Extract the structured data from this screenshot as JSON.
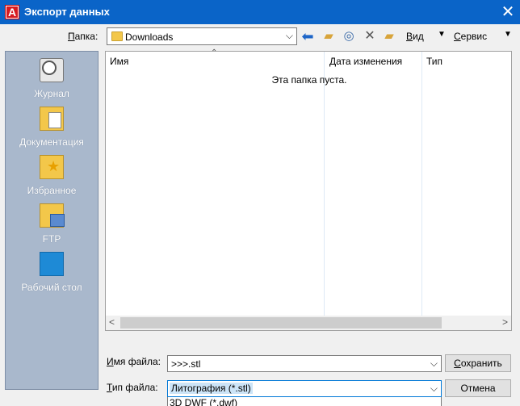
{
  "window": {
    "title": "Экспорт данных",
    "app_icon_letter": "A",
    "close_symbol": "✕"
  },
  "toolbar": {
    "folder_label": "Папка:",
    "folder_value": "Downloads",
    "view_label": "Вид",
    "tools_label": "Сервис",
    "icons": [
      "back-arrow-icon",
      "up-folder-icon",
      "search-web-icon",
      "delete-icon",
      "new-folder-icon"
    ]
  },
  "places": [
    {
      "label": "Журнал",
      "icon": "history-icon"
    },
    {
      "label": "Документация",
      "icon": "documents-folder-icon"
    },
    {
      "label": "Избранное",
      "icon": "favorites-folder-icon"
    },
    {
      "label": "FTP",
      "icon": "ftp-folder-icon"
    },
    {
      "label": "Рабочий стол",
      "icon": "desktop-icon"
    }
  ],
  "filelist": {
    "columns": [
      "Имя",
      "Дата изменения",
      "Тип"
    ],
    "empty_message": "Эта папка пуста."
  },
  "form": {
    "filename_label": "Имя файла:",
    "filename_value": ">>>.stl",
    "filetype_label": "Тип файла:",
    "filetype_value": "Литография (*.stl)",
    "dropdown_option": "3D DWF (*.dwf)",
    "save_label": "Сохранить",
    "cancel_label": "Отмена"
  },
  "colors": {
    "titlebar": "#0a64c8",
    "places_bg": "#a9b8cc",
    "selection": "#cce4f7"
  }
}
